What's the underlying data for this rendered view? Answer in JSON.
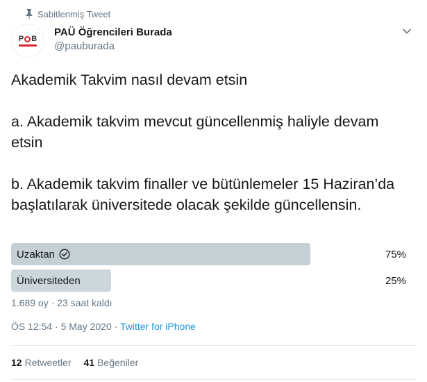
{
  "pinned": {
    "label": "Sabitlenmiş Tweet"
  },
  "user": {
    "name": "PAÜ Öğrencileri Burada",
    "handle": "@pauburada",
    "avatar_text_left": "P",
    "avatar_text_right": "B"
  },
  "tweet": {
    "text": "Akademik Takvim nasıl devam etsin\n\na. Akademik takvim mevcut güncellenmiş haliyle devam etsin\n\nb. Akademik takvim finaller ve bütünlemeler 15 Haziran’da başlatılarak üniversitede olacak şekilde güncellensin."
  },
  "poll": {
    "options": [
      {
        "label": "Uzaktan",
        "percent": "75%",
        "fraction": 0.75,
        "winner": true
      },
      {
        "label": "Üniversiteden",
        "percent": "25%",
        "fraction": 0.25,
        "winner": false
      }
    ],
    "meta": "1.689 oy · 23 saat kaldı"
  },
  "timestamp": {
    "time": "ÖS 12:54 · 5 May 2020 · ",
    "source": "Twitter for iPhone"
  },
  "stats": {
    "retweets_count": "12",
    "retweets_label": "Retweetler",
    "likes_count": "41",
    "likes_label": "Beğeniler"
  },
  "icons": {
    "pin": "pin-icon",
    "caret": "chevron-down-icon",
    "winner": "check-circle-icon"
  },
  "colors": {
    "accent": "#1b95e0",
    "muted": "#657786",
    "poll_bar": "#ccd6dd",
    "brand_red": "#d9242b"
  }
}
